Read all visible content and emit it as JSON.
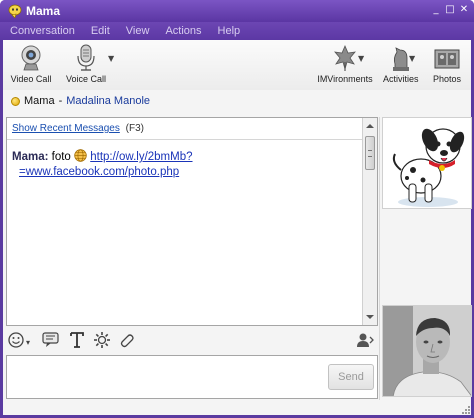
{
  "window": {
    "title": "Mama"
  },
  "menu": [
    "Conversation",
    "Edit",
    "View",
    "Actions",
    "Help"
  ],
  "toolbar": {
    "video_call": "Video Call",
    "voice_call": "Voice Call",
    "imvironments": "IMVironments",
    "activities": "Activities",
    "photos": "Photos"
  },
  "contact": {
    "nickname": "Mama",
    "separator": "-",
    "full_name": "Madalina Manole",
    "status_color": "#f2c200"
  },
  "conversation": {
    "recent_link": "Show Recent Messages",
    "recent_shortcut": "(F3)",
    "message": {
      "sender": "Mama:",
      "text": "foto",
      "link_line1": "http://ow.ly/2bmMb?",
      "link_line2": "=www.facebook.com/photo.php"
    }
  },
  "format_bar": {
    "icons": [
      "emoticon-icon",
      "audibles-icon",
      "text-format-icon",
      "imvironment-icon",
      "paperclip-icon",
      "contact-info-icon"
    ]
  },
  "input": {
    "value": "",
    "send_label": "Send"
  },
  "colors": {
    "title_bar": "#6a45b6",
    "link": "#1a34b8",
    "menu_text": "#d8cdf0"
  }
}
